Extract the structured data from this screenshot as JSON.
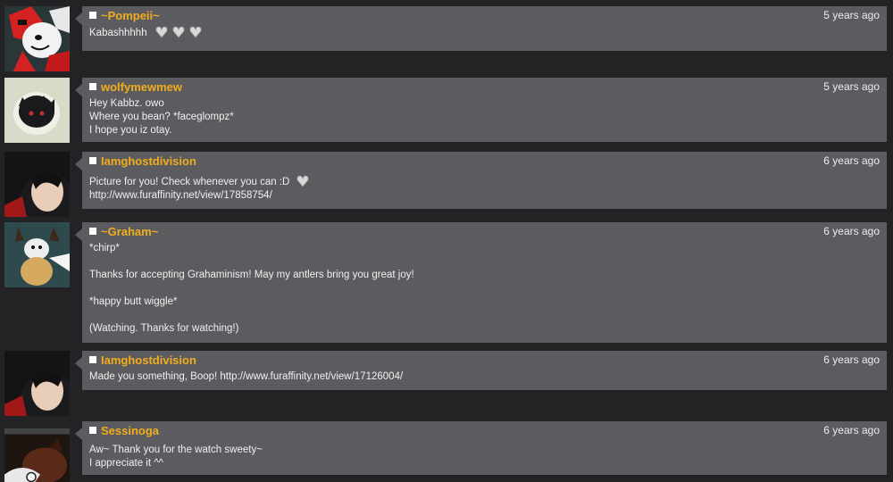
{
  "comments": [
    {
      "username": "~Pompeii~",
      "timestamp": "5 years ago",
      "lines": [
        "Kabashhhhh"
      ],
      "emotes": [
        "heart-emote",
        "heart-emote",
        "heart-emote"
      ]
    },
    {
      "username": "wolfymewmew",
      "timestamp": "5 years ago",
      "lines": [
        "Hey Kabbz. owo",
        "Where you bean? *faceglompz*",
        "I hope you iz otay."
      ]
    },
    {
      "username": "Iamghostdivision",
      "timestamp": "6 years ago",
      "lines": [
        "Picture for you! Check whenever you can :D",
        "http://www.furaffinity.net/view/17858754/"
      ],
      "emotes": [
        "heart-emote"
      ]
    },
    {
      "username": "~Graham~",
      "timestamp": "6 years ago",
      "lines": [
        "*chirp*",
        "",
        "Thanks for accepting Grahaminism! May my antlers bring you great joy!",
        "",
        "*happy butt wiggle*",
        "",
        "(Watching. Thanks for watching!)"
      ]
    },
    {
      "username": "Iamghostdivision",
      "timestamp": "6 years ago",
      "lines": [
        "Made you something, Boop! http://www.furaffinity.net/view/17126004/"
      ]
    },
    {
      "username": "Sessinoga",
      "timestamp": "6 years ago",
      "lines": [
        "Aw~ Thank you for the watch sweety~",
        "I appreciate it ^^"
      ]
    }
  ],
  "colors": {
    "background": "#232326",
    "bubble": "#5c5c60",
    "username": "#f0ad1c"
  }
}
